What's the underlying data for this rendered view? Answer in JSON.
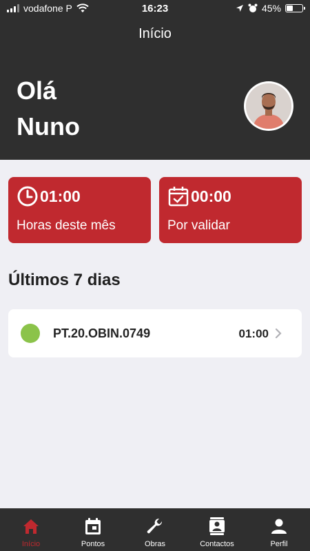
{
  "status_bar": {
    "carrier": "vodafone P",
    "time": "16:23",
    "battery": "45%",
    "battery_level": 0.45
  },
  "header": {
    "title": "Início",
    "greeting_line1": "Olá",
    "greeting_line2": "Nuno"
  },
  "cards": [
    {
      "icon": "clock-icon",
      "value": "01:00",
      "label": "Horas deste mês"
    },
    {
      "icon": "calendar-check-icon",
      "value": "00:00",
      "label": "Por validar"
    }
  ],
  "section": {
    "title": "Últimos 7 dias"
  },
  "entries": [
    {
      "status_color": "#8bc34a",
      "code": "PT.20.OBIN.0749",
      "hours": "01:00"
    }
  ],
  "tabs": [
    {
      "label": "Início",
      "icon": "home-icon",
      "active": true
    },
    {
      "label": "Pontos",
      "icon": "calendar-icon",
      "active": false
    },
    {
      "label": "Obras",
      "icon": "wrench-icon",
      "active": false
    },
    {
      "label": "Contactos",
      "icon": "contacts-icon",
      "active": false
    },
    {
      "label": "Perfil",
      "icon": "person-icon",
      "active": false
    }
  ],
  "colors": {
    "header_bg": "#2f2f2f",
    "accent_red": "#c0292f",
    "background": "#efeff4",
    "status_green": "#8bc34a"
  }
}
